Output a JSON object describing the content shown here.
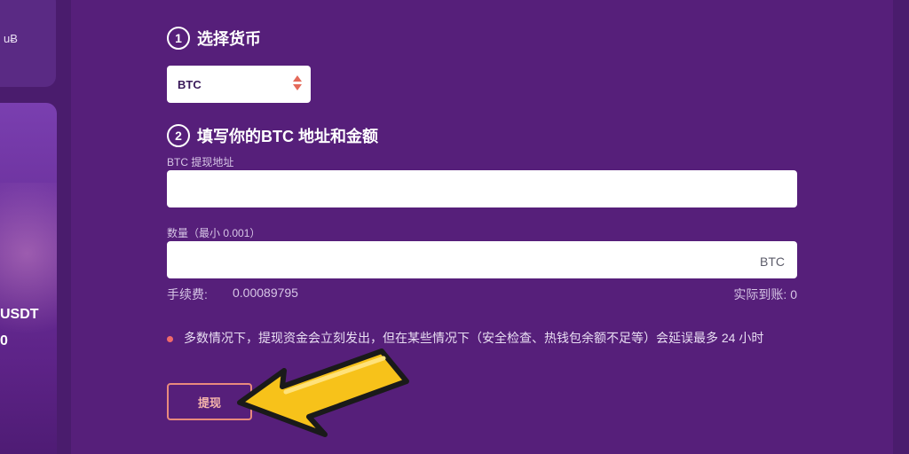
{
  "sidebar": {
    "brand_fragment": "uɃ",
    "promo": {
      "line1": "USDT",
      "line2": "0"
    }
  },
  "steps": {
    "step1": {
      "number": "1",
      "title": "选择货币"
    },
    "step2": {
      "number": "2",
      "title": "填写你的BTC 地址和金额"
    }
  },
  "currency_select": {
    "value": "BTC"
  },
  "address": {
    "label": "BTC 提现地址",
    "value": ""
  },
  "amount": {
    "label": "数量（最小 0.001）",
    "value": "",
    "suffix": "BTC"
  },
  "fee": {
    "label": "手续费:",
    "value": "0.00089795",
    "arrival_label": "实际到账: 0"
  },
  "notice": {
    "text": "多数情况下，提现资金会立刻发出，但在某些情况下（安全检查、热钱包余额不足等）会延误最多 24 小时"
  },
  "withdraw_button": {
    "label": "提现"
  },
  "colors": {
    "background": "#4a1c6d",
    "panel": "#561f7a",
    "accent": "#e46a5a",
    "arrow": "#f7c21a"
  },
  "icons": {
    "select_arrows": "sort-arrows-icon",
    "notice_dot": "bullet-dot-icon",
    "pointer": "pointing-arrow-icon"
  }
}
